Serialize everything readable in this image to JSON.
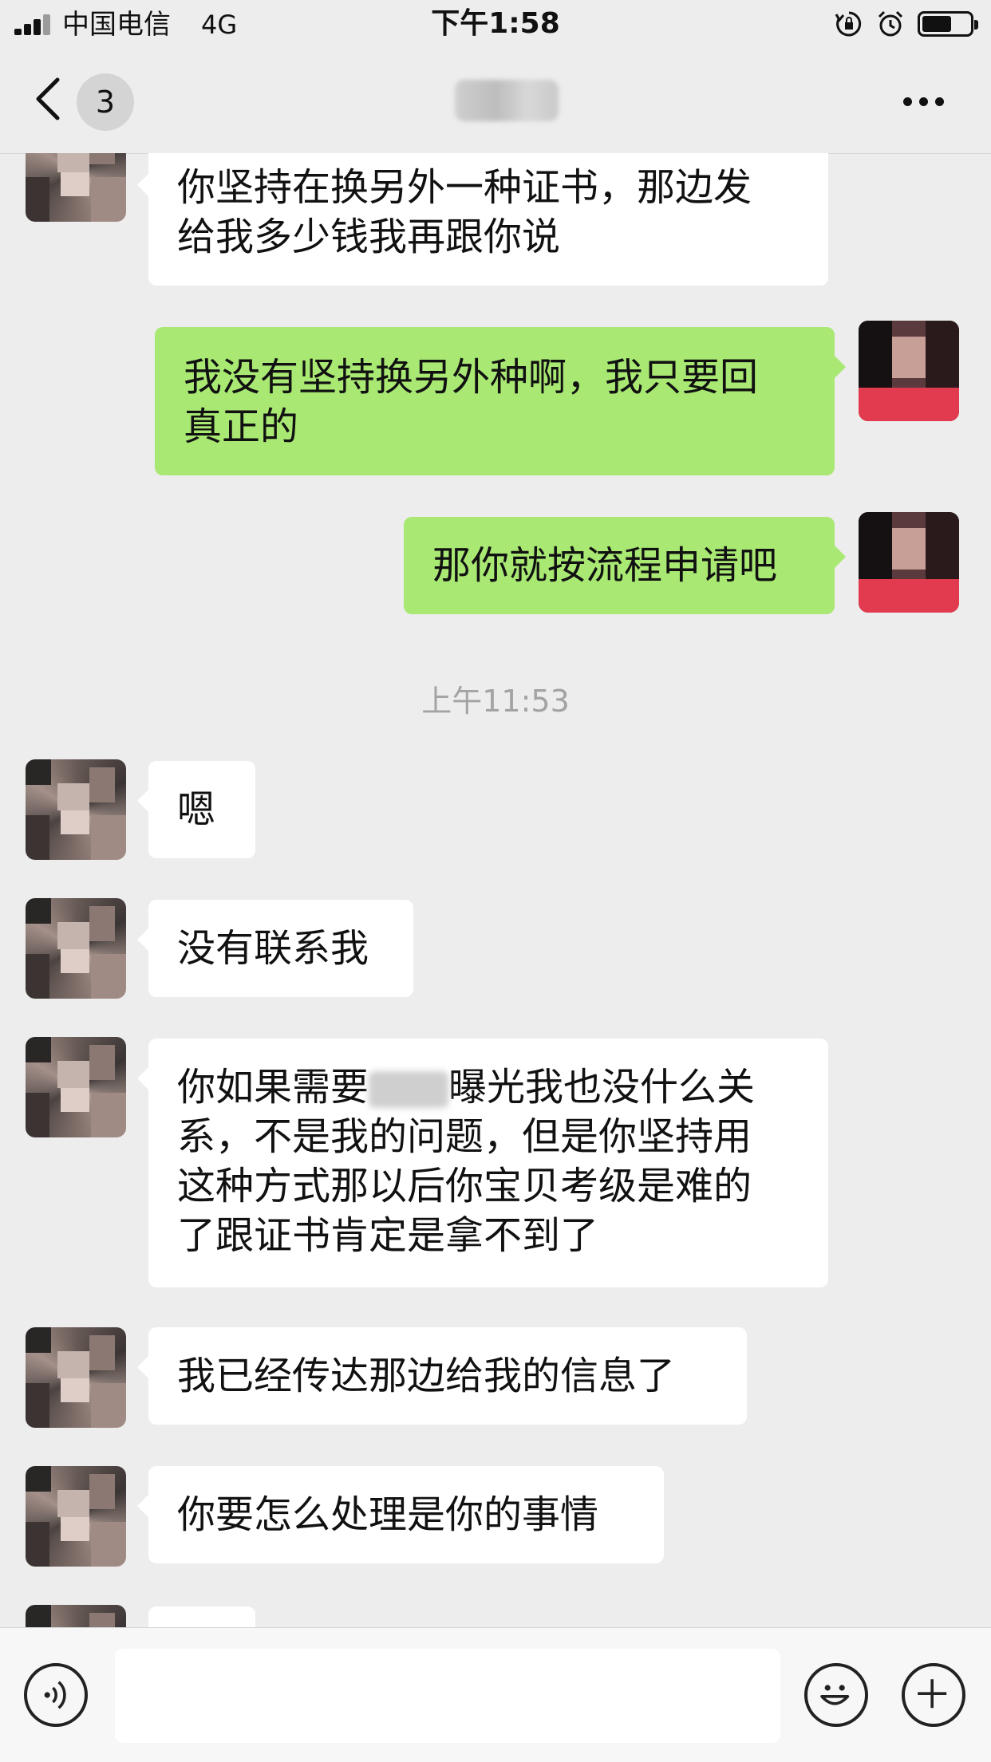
{
  "status_bar": {
    "carrier": "中国电信",
    "network": "4G",
    "time": "下午1:58"
  },
  "nav": {
    "unread_count": "3"
  },
  "icons": {
    "back": "chevron-left-icon",
    "more": "more-dots-icon",
    "voice": "voice-icon",
    "emoji": "emoji-icon",
    "plus": "plus-icon"
  },
  "colors": {
    "background": "#ededed",
    "sent_bubble": "#a8e873",
    "received_bubble": "#ffffff",
    "timestamp_text": "#a3a3a3"
  },
  "chat": {
    "timestamp": "上午11:53",
    "messages": [
      {
        "side": "left",
        "lines": [
          "你坚持在换另外一种证书，那边发",
          "给我多少钱我再跟你说"
        ]
      },
      {
        "side": "right",
        "lines": [
          "我没有坚持换另外种啊，我只要回",
          "真正的"
        ]
      },
      {
        "side": "right",
        "lines": [
          "那你就按流程申请吧"
        ]
      },
      {
        "side": "left",
        "lines": [
          "嗯"
        ]
      },
      {
        "side": "left",
        "lines": [
          "没有联系我"
        ]
      },
      {
        "side": "left",
        "line1_before": "你如果需要",
        "line1_after": "曝光我也没什么关",
        "lines": [
          "系，不是我的问题，但是你坚持用",
          "这种方式那以后你宝贝考级是难的",
          "了跟证书肯定是拿不到了"
        ]
      },
      {
        "side": "left",
        "lines": [
          "我已经传达那边给我的信息了"
        ]
      },
      {
        "side": "left",
        "lines": [
          "你要怎么处理是你的事情"
        ]
      }
    ]
  }
}
